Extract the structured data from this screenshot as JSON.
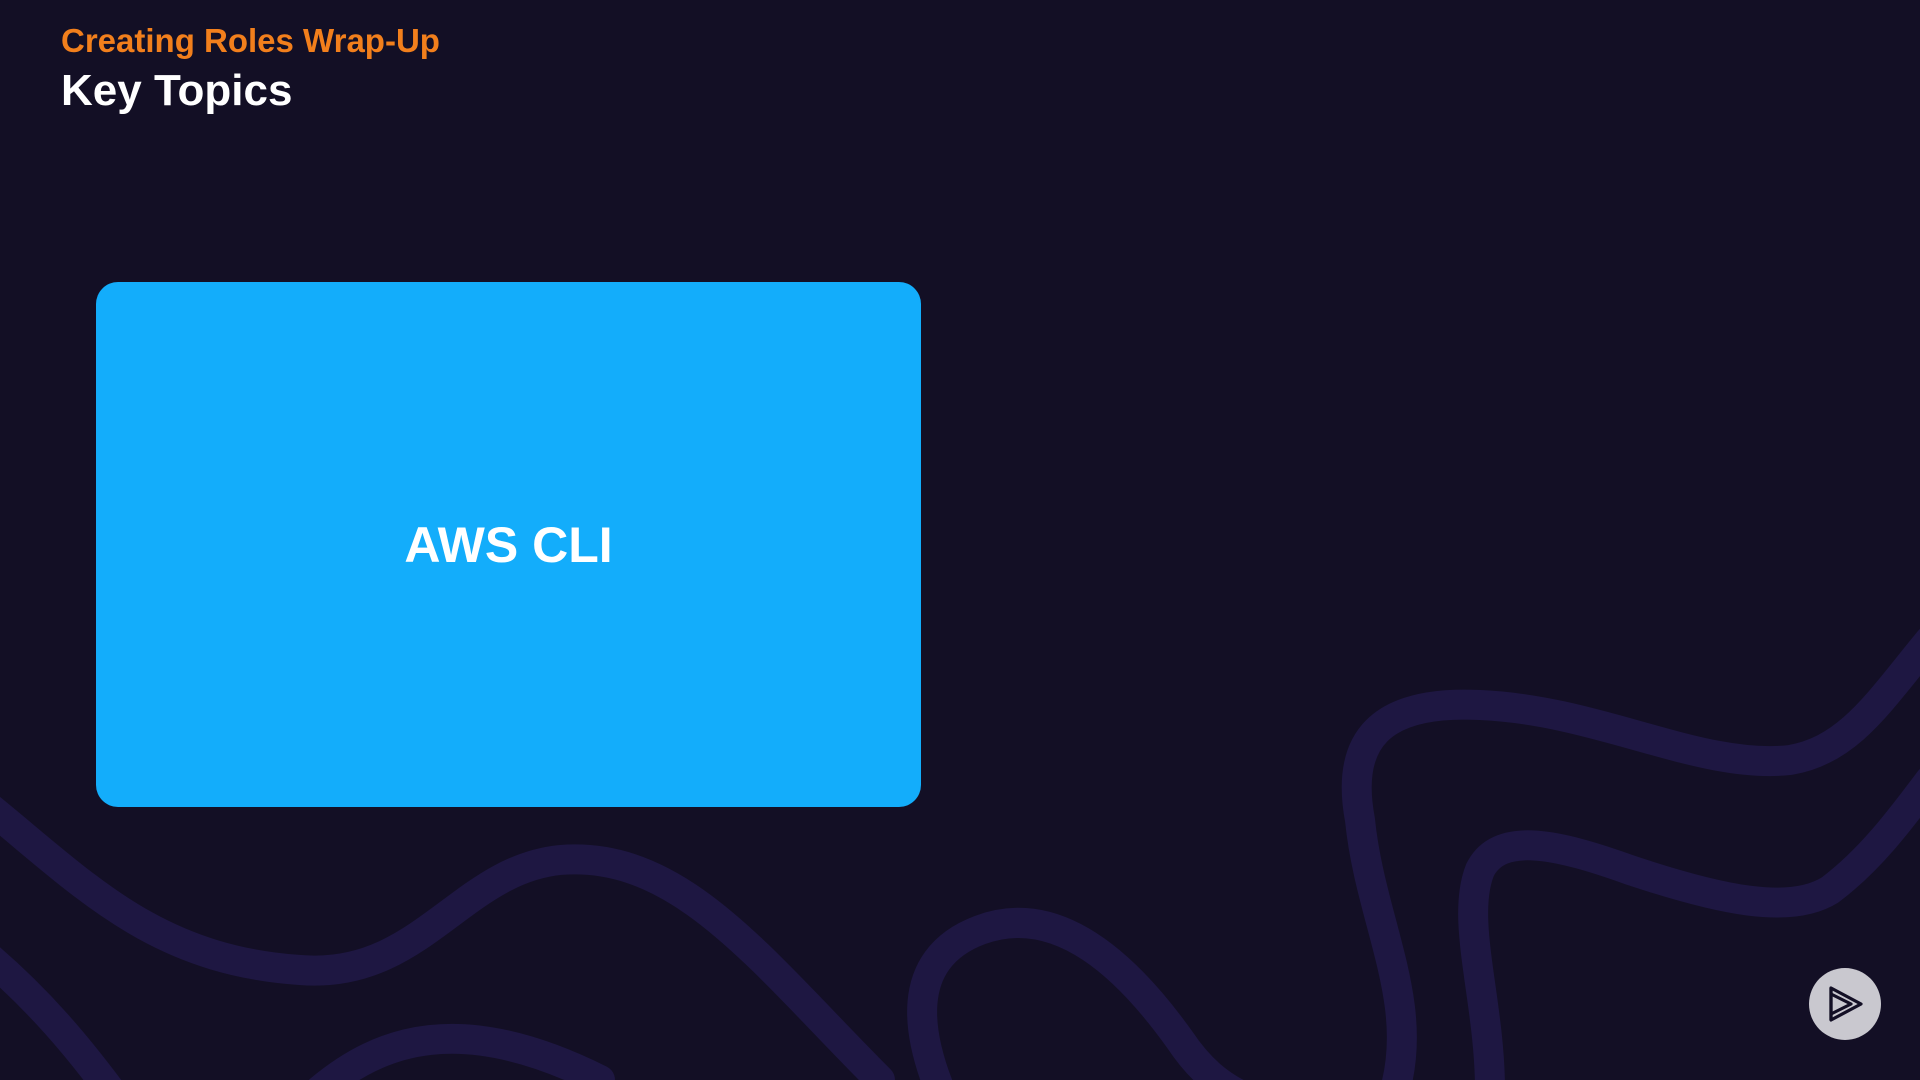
{
  "slide": {
    "eyebrow": "Creating Roles Wrap-Up",
    "title": "Key Topics",
    "topic_card": {
      "label": "AWS CLI"
    },
    "logo_icon": "play-logo-icon"
  },
  "colors": {
    "background": "#130f25",
    "eyebrow": "#f27f1c",
    "card": "#13adfb",
    "decorative_lines": "#1e1742"
  }
}
